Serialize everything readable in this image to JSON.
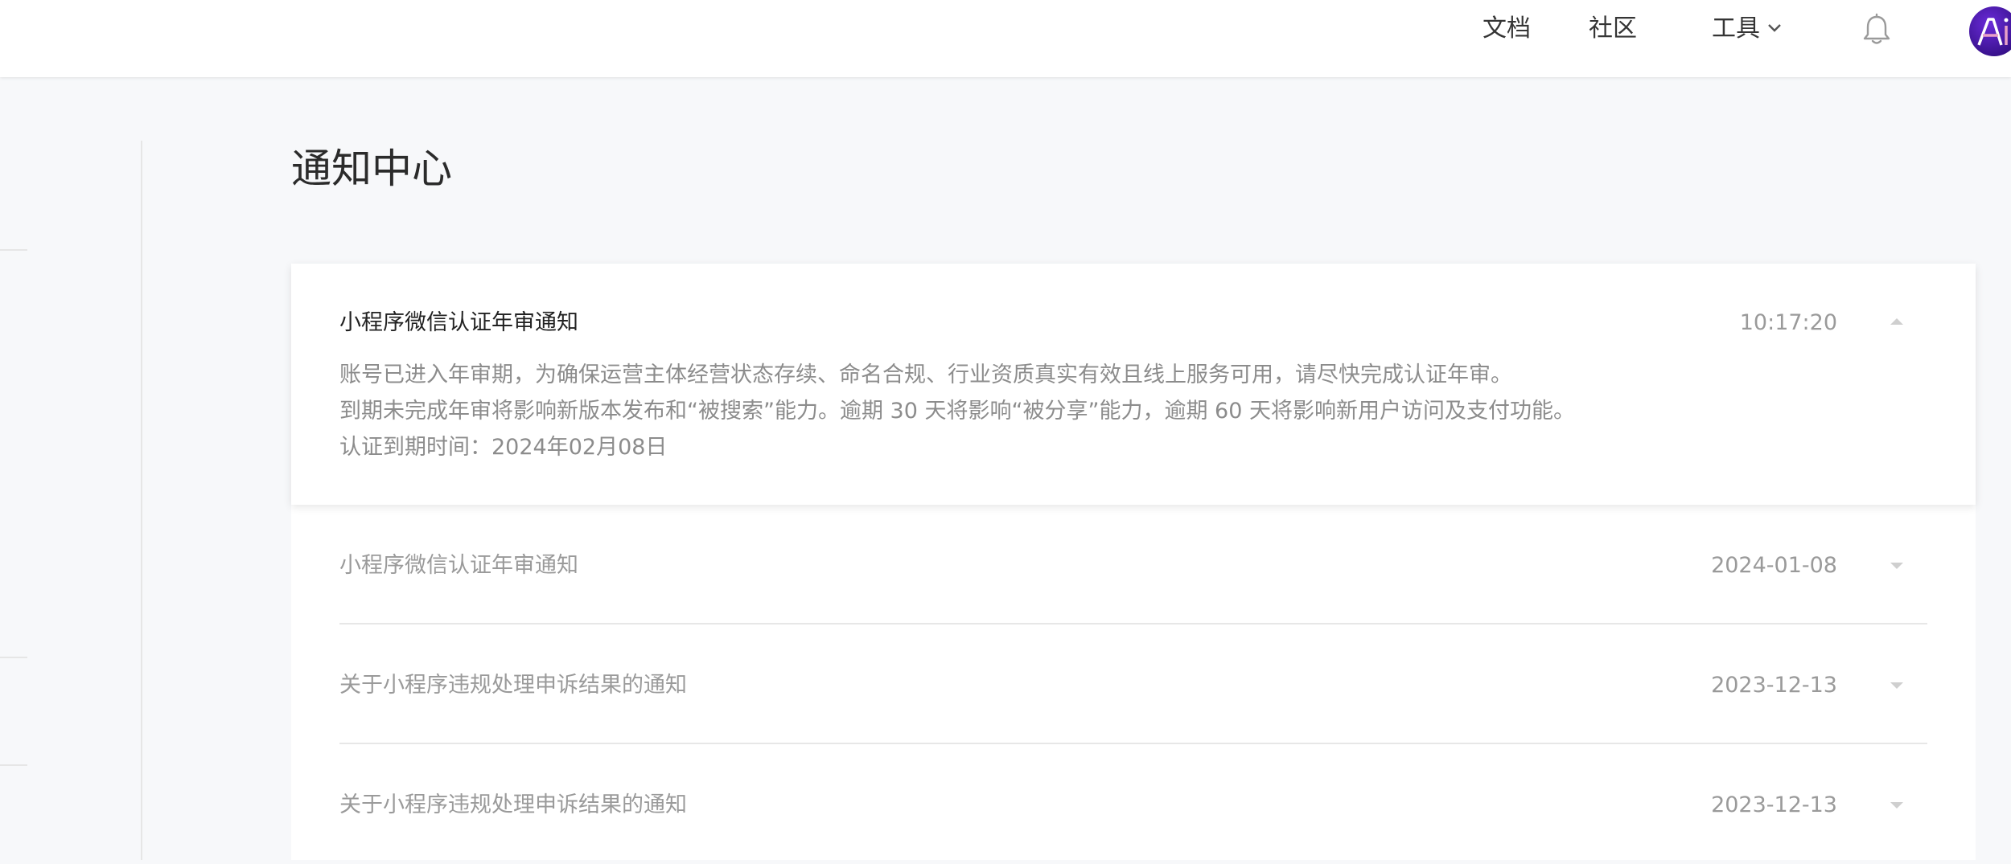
{
  "header": {
    "nav": {
      "docs": "文档",
      "community": "社区",
      "tools": "工具"
    },
    "icons": {
      "tools_dropdown": "chevron-down-icon",
      "notifications": "bell-icon",
      "avatar": "ai-avatar-icon"
    }
  },
  "main": {
    "page_title": "通知中心",
    "notices": [
      {
        "title": "小程序微信认证年审通知",
        "time": "10:17:20",
        "expanded": true,
        "body": [
          "账号已进入年审期，为确保运营主体经营状态存续、命名合规、行业资质真实有效且线上服务可用，请尽快完成认证年审。",
          "到期未完成年审将影响新版本发布和“被搜索”能力。逾期 30 天将影响“被分享”能力，逾期 60 天将影响新用户访问及支付功能。",
          "认证到期时间：2024年02月08日"
        ]
      },
      {
        "title": "小程序微信认证年审通知",
        "time": "2024-01-08",
        "expanded": false
      },
      {
        "title": "关于小程序违规处理申诉结果的通知",
        "time": "2023-12-13",
        "expanded": false
      },
      {
        "title": "关于小程序违规处理申诉结果的通知",
        "time": "2023-12-13",
        "expanded": false
      }
    ]
  },
  "colors": {
    "page_background": "#f7f8fa",
    "card_background": "#ffffff",
    "primary_text": "#222222",
    "muted_text": "#9a9a9a",
    "avatar_purple": "#4b1bb3",
    "avatar_accent": "#e8a0c8"
  }
}
